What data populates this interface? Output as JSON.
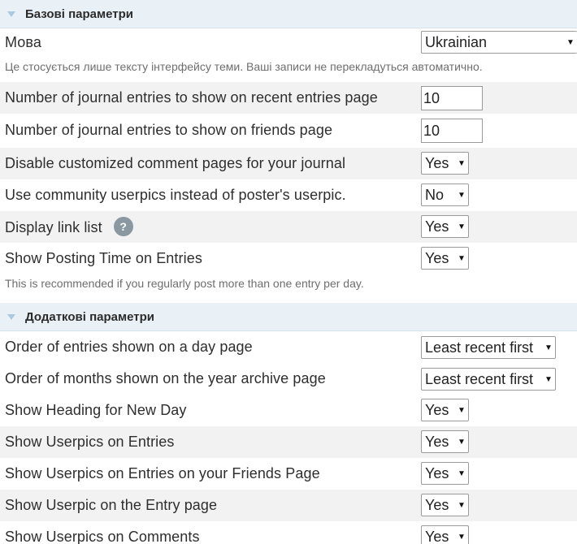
{
  "sections": {
    "basic_title": "Базові параметри",
    "extra_title": "Додаткові параметри"
  },
  "language": {
    "label": "Мова",
    "value": "Ukrainian"
  },
  "notes": {
    "language_note": "Це стосується лише тексту інтерфейсу теми. Ваші записи не перекладуться автоматично.",
    "posting_time_note": "This is recommended if you regularly post more than one entry per day."
  },
  "rows": {
    "recent_entries": {
      "label": "Number of journal entries to show on recent entries page",
      "value": "10"
    },
    "friends_entries": {
      "label": "Number of journal entries to show on friends page",
      "value": "10"
    },
    "disable_comment_pages": {
      "label": "Disable customized comment pages for your journal",
      "value": "Yes"
    },
    "community_userpics": {
      "label": "Use community userpics instead of poster's userpic.",
      "value": "No"
    },
    "link_list": {
      "label": "Display link list",
      "value": "Yes",
      "help": "?"
    },
    "posting_time": {
      "label": "Show Posting Time on Entries",
      "value": "Yes"
    },
    "order_day": {
      "label": "Order of entries shown on a day page",
      "value": "Least recent first"
    },
    "order_months": {
      "label": "Order of months shown on the year archive page",
      "value": "Least recent first"
    },
    "heading_new_day": {
      "label": "Show Heading for New Day",
      "value": "Yes"
    },
    "userpics_entries": {
      "label": "Show Userpics on Entries",
      "value": "Yes"
    },
    "userpics_friends": {
      "label": "Show Userpics on Entries on your Friends Page",
      "value": "Yes"
    },
    "userpic_entry_page": {
      "label": "Show Userpic on the Entry page",
      "value": "Yes"
    },
    "userpics_comments": {
      "label": "Show Userpics on Comments",
      "value": "Yes"
    }
  },
  "icons": {
    "collapse": "triangle-down-icon",
    "help": "question-icon",
    "dropdown": "chevron-down-icon"
  },
  "colors": {
    "section_bg": "#eaf1f6",
    "row_shade": "#f2f2f2",
    "help_bg": "#8a98a2"
  }
}
